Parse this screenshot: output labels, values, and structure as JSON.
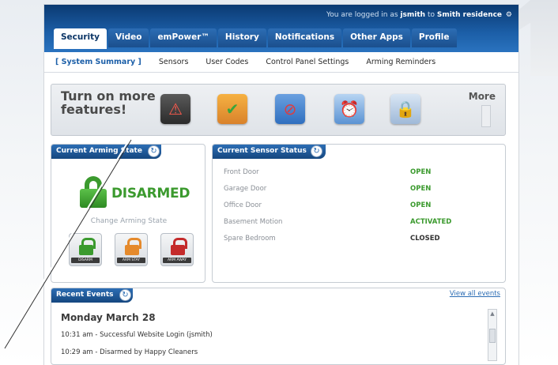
{
  "header": {
    "login_prefix": "You are logged in as",
    "username": "jsmith",
    "login_mid": "to",
    "residence": "Smith residence"
  },
  "tabs": [
    {
      "label": "Security",
      "active": true
    },
    {
      "label": "Video"
    },
    {
      "label": "emPower™"
    },
    {
      "label": "History"
    },
    {
      "label": "Notifications"
    },
    {
      "label": "Other Apps"
    },
    {
      "label": "Profile"
    }
  ],
  "subnav": [
    {
      "label": "[ System Summary ]",
      "current": true
    },
    {
      "label": "Sensors"
    },
    {
      "label": "User Codes"
    },
    {
      "label": "Control Panel Settings"
    },
    {
      "label": "Arming Reminders"
    }
  ],
  "promo": {
    "title": "Turn on more features!",
    "more_label": "More",
    "features": [
      "phone-alert-icon",
      "thermostat-icon",
      "no-motion-icon",
      "alarm-clock-icon",
      "lock-icon"
    ]
  },
  "arming": {
    "title": "Current Arming State",
    "state": "DISARMED",
    "state_color": "#3b9a2e",
    "change_label": "Change Arming State",
    "modes": [
      "DISARM",
      "ARM STAY",
      "ARM AWAY"
    ]
  },
  "sensors": {
    "title": "Current Sensor Status",
    "rows": [
      {
        "name": "Front Door",
        "status": "OPEN",
        "color": "#3b9a2e"
      },
      {
        "name": "Garage Door",
        "status": "OPEN",
        "color": "#3b9a2e"
      },
      {
        "name": "Office Door",
        "status": "OPEN",
        "color": "#3b9a2e"
      },
      {
        "name": "Basement Motion",
        "status": "ACTIVATED",
        "color": "#3b9a2e"
      },
      {
        "name": "Spare Bedroom",
        "status": "CLOSED",
        "color": "#333333"
      }
    ]
  },
  "events": {
    "title": "Recent Events",
    "view_all": "View all events",
    "date": "Monday March 28",
    "items": [
      "10:31 am - Successful Website Login (jsmith)",
      "10:29 am - Disarmed by Happy Cleaners"
    ]
  }
}
